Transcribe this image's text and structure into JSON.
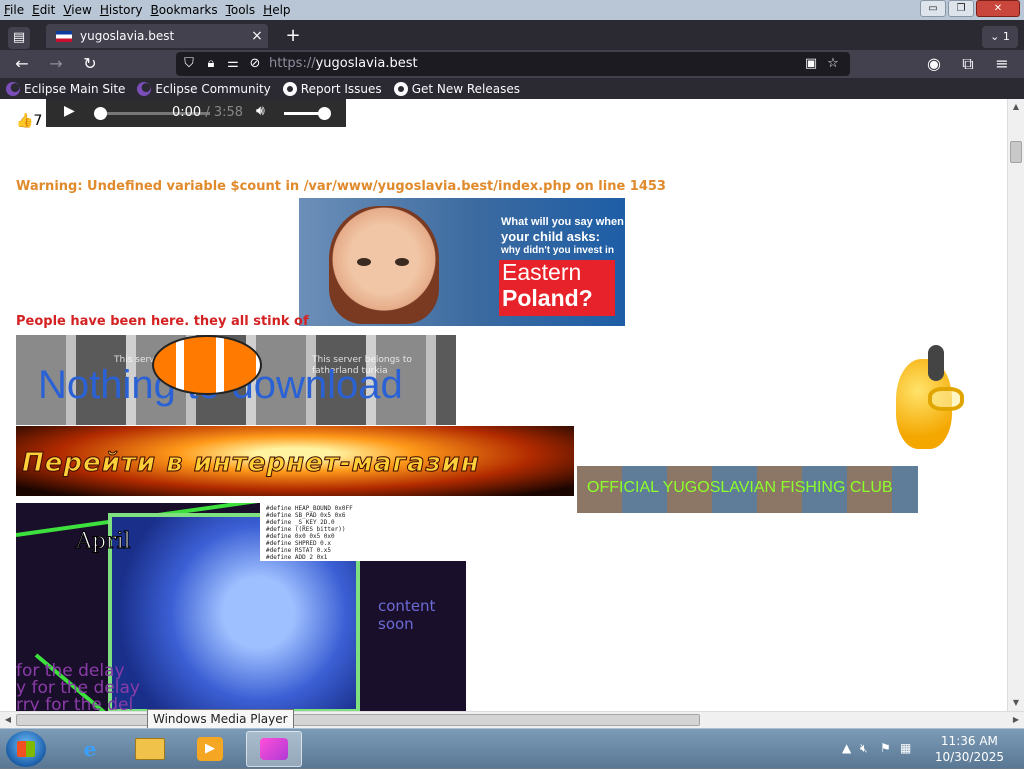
{
  "menubar": {
    "items": [
      {
        "label": "File",
        "u": "F",
        "rest": "ile"
      },
      {
        "label": "Edit",
        "u": "E",
        "rest": "dit"
      },
      {
        "label": "View",
        "u": "V",
        "rest": "iew"
      },
      {
        "label": "History",
        "u": "H",
        "rest": "istory"
      },
      {
        "label": "Bookmarks",
        "u": "B",
        "rest": "ookmarks"
      },
      {
        "label": "Tools",
        "u": "T",
        "rest": "ools"
      },
      {
        "label": "Help",
        "u": "H",
        "rest": "elp"
      }
    ]
  },
  "window_controls": {
    "minimize": "▭",
    "restore": "❐",
    "close": "✕"
  },
  "tabs": {
    "active_title": "yugoslavia.best",
    "close_icon": "×",
    "new_tab_icon": "+",
    "tab_count": "1"
  },
  "navbar": {
    "url_scheme": "https://",
    "url_host": "yugoslavia.best"
  },
  "bookmarks": [
    {
      "label": "Eclipse Main Site",
      "icon": "eclipse-icon"
    },
    {
      "label": "Eclipse Community",
      "icon": "eclipse-icon"
    },
    {
      "label": "Report Issues",
      "icon": "github-icon"
    },
    {
      "label": "Get New Releases",
      "icon": "github-icon"
    }
  ],
  "page": {
    "likes_icon": "👍",
    "likes_count": "7",
    "audio": {
      "current": "0:00",
      "duration": "3:58",
      "separator": " / "
    },
    "warning": "Warning: Undefined variable $count in /var/www/yugoslavia.best/index.php on line 1453",
    "poland_ad": {
      "line1": "What will you say when",
      "line2": "your child asks:",
      "line3": "why didn't you invest in",
      "eastern": "Eastern",
      "poland": "Poland?"
    },
    "stink_text": "People have been here. they all stink of",
    "nothing_banner": {
      "big": "Nothing to download",
      "small1": "This server belongs to",
      "small2": "fatherland turkia"
    },
    "shop_banner": "Перейти в интернет-магазин",
    "fishing_club": "OFFICIAL YUGOSLAVIAN FISHING CLUB",
    "collage": {
      "april": "April",
      "soon": "content soon",
      "delay1": "for the delay",
      "delay2": "y for the delay",
      "delay3": "rry for the del"
    }
  },
  "tooltip": "Windows Media Player",
  "taskbar": {
    "time": "11:36 AM",
    "date": "10/30/2025"
  }
}
